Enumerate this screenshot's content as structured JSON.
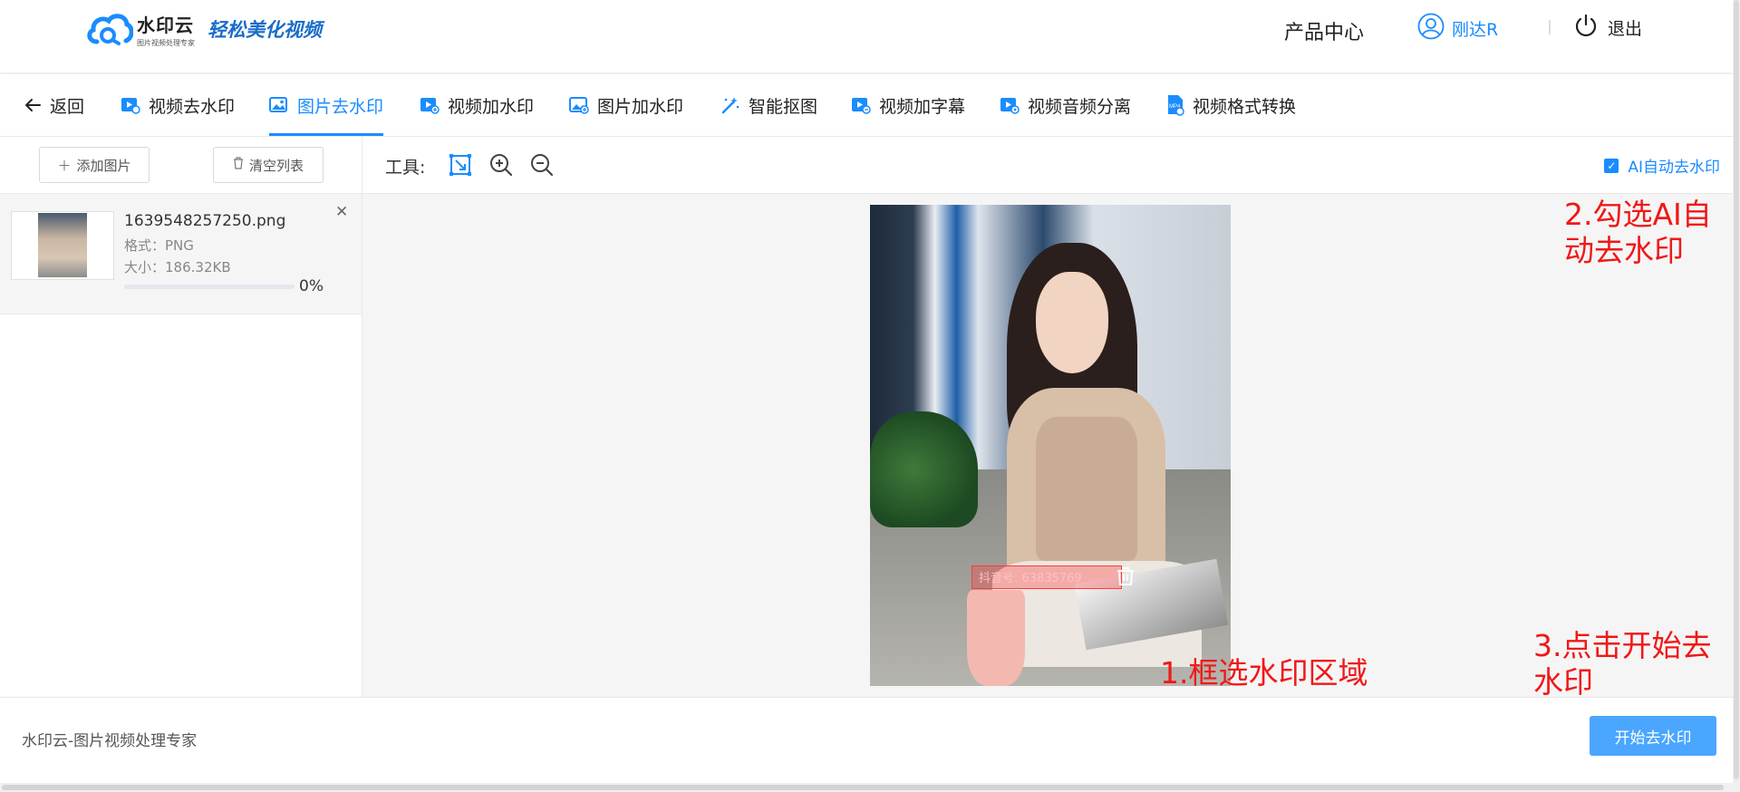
{
  "header": {
    "brand_name": "水印云",
    "brand_sub": "图片视频处理专家",
    "slogan": "轻松美化视频",
    "product_center": "产品中心",
    "user_name": "刚达R",
    "logout": "退出"
  },
  "nav": {
    "back": "返回",
    "tabs": [
      {
        "label": "视频去水印",
        "icon": "video-icon"
      },
      {
        "label": "图片去水印",
        "icon": "image-icon",
        "active": true
      },
      {
        "label": "视频加水印",
        "icon": "video-add-icon"
      },
      {
        "label": "图片加水印",
        "icon": "image-add-icon"
      },
      {
        "label": "智能抠图",
        "icon": "magic-wand-icon"
      },
      {
        "label": "视频加字幕",
        "icon": "video-subtitle-icon"
      },
      {
        "label": "视频音频分离",
        "icon": "audio-split-icon"
      },
      {
        "label": "视频格式转换",
        "icon": "mp4-file-icon"
      }
    ]
  },
  "sidebar": {
    "add_image": "添加图片",
    "clear_list": "清空列表",
    "file": {
      "name": "1639548257250.png",
      "format": "格式：PNG",
      "size": "大小：186.32KB",
      "progress": 0,
      "progress_text": "0%"
    }
  },
  "toolbar": {
    "label": "工具:",
    "ai_auto": "AI自动去水印",
    "ai_checked": true
  },
  "canvas": {
    "watermark_text": "抖音号: 63835769",
    "annotation_1": "1.框选水印区域",
    "annotation_2_line1": "2.勾选AI自",
    "annotation_2_line2": "动去水印",
    "annotation_3_line1": "3.点击开始去",
    "annotation_3_line2": "水印"
  },
  "footer": {
    "text": "水印云-图片视频处理专家",
    "start_button": "开始去水印"
  },
  "colors": {
    "accent": "#1a8cff",
    "button": "#4aa6ff",
    "annotation": "#f01818"
  }
}
